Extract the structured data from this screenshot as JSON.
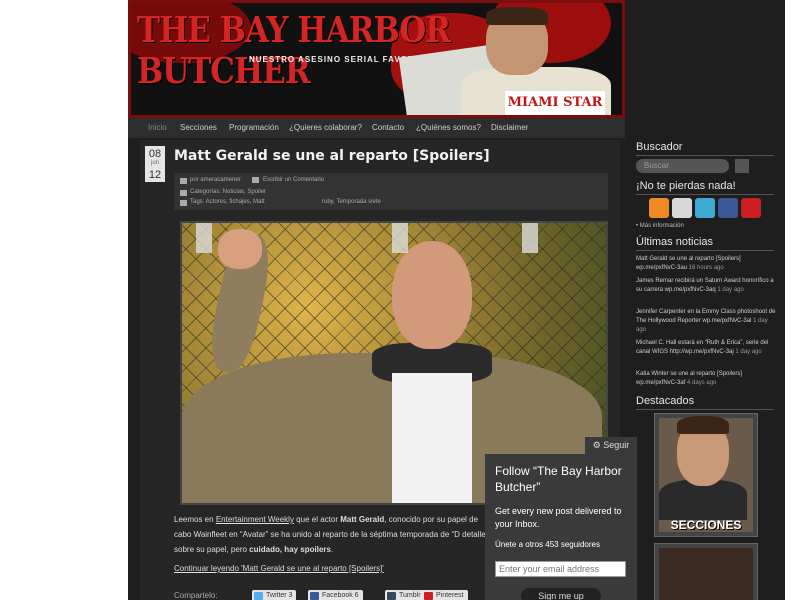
{
  "header": {
    "title": "THE BAY HARBOR BUTCHER",
    "subtitle": "NUESTRO ASESINO SERIAL FAVORITO",
    "newspaper": "MIAMI STAR"
  },
  "nav": {
    "items": [
      "Inicio",
      "Secciones",
      "Programación",
      "¿Quieres colaborar?",
      "Contacto",
      "¿Quiénes somos?",
      "Disclaimer"
    ]
  },
  "post": {
    "date": {
      "day": "08",
      "month": "jun",
      "year": "12"
    },
    "title": "Matt Gerald se une al reparto [Spoilers]",
    "meta": {
      "author": "por ameracamener",
      "comment": "Escribir un Comentario",
      "categories": "Categorías: Noticias, Spoiler",
      "tags": "Tags: Actores, fichajes, Matt",
      "tags_extra": "ruby, Temporada siete"
    },
    "body": {
      "part1": "Leemos en",
      "source": "Entertainment Weekly",
      "part2": "que el actor",
      "actor": "Matt Gerald",
      "part3": ", conocido por su papel de cabo Wainfleet en “Avatar” se ha unido al reparto de la séptima temporada de “D",
      "part4": "detalles sobre su papel, pero",
      "warn": "cuidado, hay spoilers",
      "end": "."
    },
    "more": "Continuar leyendo 'Matt Gerald se une al reparto [Spoilers]'",
    "share_label": "Compartelo:",
    "share": {
      "twitter": "Twitter 3",
      "facebook": "Facebook 6",
      "tumblr": "Tumblr",
      "pinterest": "Pinterest"
    }
  },
  "follow": {
    "tab": "Seguir",
    "title": "Follow “The Bay Harbor Butcher”",
    "desc": "Get every new post delivered to your Inbox.",
    "count": "Únete a otros 453 seguidores",
    "placeholder": "Enter your email address",
    "signup": "Sign me up"
  },
  "sidebar": {
    "search_title": "Buscador",
    "search_placeholder": "Buscar",
    "follow_title": "¡No te pierdas nada!",
    "more_info": "• Más información",
    "news_title": "Últimas noticias",
    "news": [
      {
        "text": "Matt Gerald se une al reparto [Spoilers]",
        "time": "16 hours ago"
      },
      {
        "text": "James Remar recibirá un Saturn Award honorífico a su carrera wp.me/pxfNvC-3aq",
        "time": "1 day ago"
      },
      {
        "text": "Jennifer Carpenter en la Emmy Class photoshoot de The Hollywood Reporter wp.me/pxfNvC-3al",
        "time": "1 day ago"
      },
      {
        "text": "Michael C. Hall estará en “Ruth & Erica”, serie del canal WIGS http://wp.me/pxfNvC-3aj",
        "time": "1 day ago"
      },
      {
        "text": "Katia Winter se une al reparto [Spoilers] wp.me/pxfNvC-3af",
        "time": "4 days ago"
      }
    ],
    "news_prefix": "wp.me/pxfNvC-3au",
    "featured_title": "Destacados",
    "featured_label": "SECCIONES"
  },
  "colors": {
    "accent": "#c01515",
    "bg": "#1e1e1e",
    "panel": "#262626"
  }
}
